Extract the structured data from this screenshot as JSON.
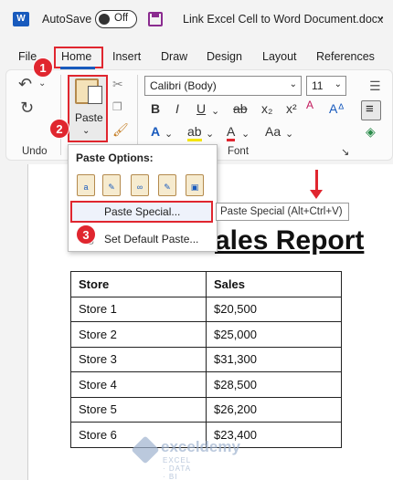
{
  "titlebar": {
    "app_logo": "W",
    "autosave_label": "AutoSave",
    "autosave_state": "Off",
    "doc_title": "Link Excel Cell to Word Document.docx",
    "title_chevron": "⌄"
  },
  "menu": {
    "items": [
      "File",
      "Home",
      "Insert",
      "Draw",
      "Design",
      "Layout",
      "References"
    ]
  },
  "ribbon": {
    "undo_group_label": "Undo",
    "font_group_label": "Font",
    "paste_label": "Paste",
    "paste_chevron": "⌄",
    "font_name": "Calibri (Body)",
    "font_size": "11",
    "bold": "B",
    "italic": "I",
    "underline": "U",
    "strike": "ab",
    "subscript": "x₂",
    "superscript": "x²",
    "text_effects": "A",
    "highlight": "ab",
    "font_color": "A",
    "grow_font": "Aᐞ",
    "shrink_font": "Aˇ",
    "clear_format": "A",
    "font_launcher": "↘"
  },
  "dropdown": {
    "heading": "Paste Options:",
    "paste_special": "Paste Special...",
    "set_default": "Set Default Paste...",
    "tooltip": "Paste Special (Alt+Ctrl+V)"
  },
  "badges": [
    "1",
    "2",
    "3"
  ],
  "document": {
    "title_visible": "ales Report",
    "table": {
      "headers": [
        "Store",
        "Sales"
      ],
      "rows": [
        [
          "Store 1",
          "$20,500"
        ],
        [
          "Store 2",
          "$25,000"
        ],
        [
          "Store 3",
          "$31,300"
        ],
        [
          "Store 4",
          "$28,500"
        ],
        [
          "Store 5",
          "$26,200"
        ],
        [
          "Store 6",
          "$23,400"
        ]
      ]
    }
  },
  "watermark": {
    "name": "exceldemy",
    "sub": "EXCEL · DATA · BI"
  },
  "colors": {
    "highlight_red": "#e0262f",
    "word_blue": "#185abd"
  }
}
